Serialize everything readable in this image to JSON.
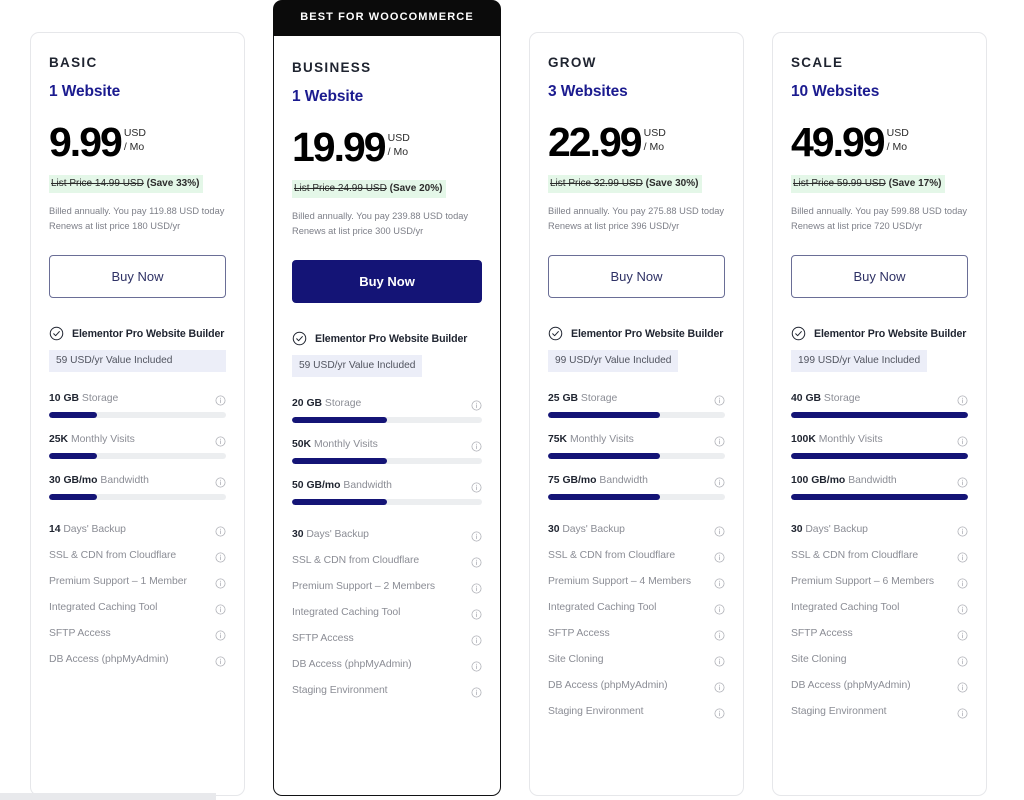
{
  "icons": {
    "check": "check-circle-icon",
    "info": "info-circle-icon"
  },
  "colors": {
    "brand_navy": "#141476",
    "plan_sites": "#1b1b8f",
    "save_badge_bg": "#e4f7e8",
    "value_box_bg": "#eceef8",
    "meter_track": "#eceef0",
    "ribbon_bg": "#0b0b0b",
    "card_border": "#e6e7ea"
  },
  "plans": [
    {
      "ribbon": null,
      "featured": false,
      "name": "BASIC",
      "sites": "1 Website",
      "price": "9.99",
      "currency": "USD",
      "period": "/ Mo",
      "list_price": "List Price 14.99 USD",
      "save": "(Save 33%)",
      "billing_line1": "Billed annually. You pay 119.88 USD today",
      "billing_line2": "Renews at list price 180 USD/yr",
      "cta": "Buy Now",
      "elementor": "Elementor Pro Website Builder",
      "value_included": "59 USD/yr Value Included",
      "value_box_full": true,
      "meters": [
        {
          "value": "10 GB",
          "label": "Storage",
          "percent": 27
        },
        {
          "value": "25K",
          "label": "Monthly Visits",
          "percent": 27
        },
        {
          "value": "30 GB/mo",
          "label": "Bandwidth",
          "percent": 27
        }
      ],
      "features": [
        {
          "value": "14",
          "label": "Days' Backup"
        },
        {
          "value": "",
          "label": "SSL & CDN from Cloudflare"
        },
        {
          "value": "",
          "label": "Premium Support – 1 Member"
        },
        {
          "value": "",
          "label": "Integrated Caching Tool"
        },
        {
          "value": "",
          "label": "SFTP Access"
        },
        {
          "value": "",
          "label": "DB Access (phpMyAdmin)"
        }
      ]
    },
    {
      "ribbon": "BEST FOR WOOCOMMERCE",
      "featured": true,
      "name": "BUSINESS",
      "sites": "1 Website",
      "price": "19.99",
      "currency": "USD",
      "period": "/ Mo",
      "list_price": "List Price 24.99 USD",
      "save": "(Save 20%)",
      "billing_line1": "Billed annually. You pay 239.88 USD today",
      "billing_line2": "Renews at list price 300 USD/yr",
      "cta": "Buy Now",
      "elementor": "Elementor Pro Website Builder",
      "value_included": "59 USD/yr Value Included",
      "value_box_full": false,
      "meters": [
        {
          "value": "20 GB",
          "label": "Storage",
          "percent": 50
        },
        {
          "value": "50K",
          "label": "Monthly Visits",
          "percent": 50
        },
        {
          "value": "50 GB/mo",
          "label": "Bandwidth",
          "percent": 50
        }
      ],
      "features": [
        {
          "value": "30",
          "label": "Days' Backup"
        },
        {
          "value": "",
          "label": "SSL & CDN from Cloudflare"
        },
        {
          "value": "",
          "label": "Premium Support – 2 Members"
        },
        {
          "value": "",
          "label": "Integrated Caching Tool"
        },
        {
          "value": "",
          "label": "SFTP Access"
        },
        {
          "value": "",
          "label": "DB Access (phpMyAdmin)"
        },
        {
          "value": "",
          "label": "Staging Environment"
        }
      ]
    },
    {
      "ribbon": null,
      "featured": false,
      "name": "GROW",
      "sites": "3 Websites",
      "price": "22.99",
      "currency": "USD",
      "period": "/ Mo",
      "list_price": "List Price 32.99 USD",
      "save": "(Save 30%)",
      "billing_line1": "Billed annually. You pay 275.88 USD today",
      "billing_line2": "Renews at list price 396 USD/yr",
      "cta": "Buy Now",
      "elementor": "Elementor Pro Website Builder",
      "value_included": "99 USD/yr Value Included",
      "value_box_full": false,
      "meters": [
        {
          "value": "25 GB",
          "label": "Storage",
          "percent": 63
        },
        {
          "value": "75K",
          "label": "Monthly Visits",
          "percent": 63
        },
        {
          "value": "75 GB/mo",
          "label": "Bandwidth",
          "percent": 63
        }
      ],
      "features": [
        {
          "value": "30",
          "label": "Days' Backup"
        },
        {
          "value": "",
          "label": "SSL & CDN from Cloudflare"
        },
        {
          "value": "",
          "label": "Premium Support – 4 Members"
        },
        {
          "value": "",
          "label": "Integrated Caching Tool"
        },
        {
          "value": "",
          "label": "SFTP Access"
        },
        {
          "value": "",
          "label": "Site Cloning"
        },
        {
          "value": "",
          "label": "DB Access (phpMyAdmin)"
        },
        {
          "value": "",
          "label": "Staging Environment"
        }
      ]
    },
    {
      "ribbon": null,
      "featured": false,
      "name": "SCALE",
      "sites": "10 Websites",
      "price": "49.99",
      "currency": "USD",
      "period": "/ Mo",
      "list_price": "List Price 59.99 USD",
      "save": "(Save 17%)",
      "billing_line1": "Billed annually. You pay 599.88 USD today",
      "billing_line2": "Renews at list price 720 USD/yr",
      "cta": "Buy Now",
      "elementor": "Elementor Pro Website Builder",
      "value_included": "199 USD/yr Value Included",
      "value_box_full": false,
      "meters": [
        {
          "value": "40 GB",
          "label": "Storage",
          "percent": 100
        },
        {
          "value": "100K",
          "label": "Monthly Visits",
          "percent": 100
        },
        {
          "value": "100 GB/mo",
          "label": "Bandwidth",
          "percent": 100
        }
      ],
      "features": [
        {
          "value": "30",
          "label": "Days' Backup"
        },
        {
          "value": "",
          "label": "SSL & CDN from Cloudflare"
        },
        {
          "value": "",
          "label": "Premium Support – 6 Members"
        },
        {
          "value": "",
          "label": "Integrated Caching Tool"
        },
        {
          "value": "",
          "label": "SFTP Access"
        },
        {
          "value": "",
          "label": "Site Cloning"
        },
        {
          "value": "",
          "label": "DB Access (phpMyAdmin)"
        },
        {
          "value": "",
          "label": "Staging Environment"
        }
      ]
    }
  ]
}
